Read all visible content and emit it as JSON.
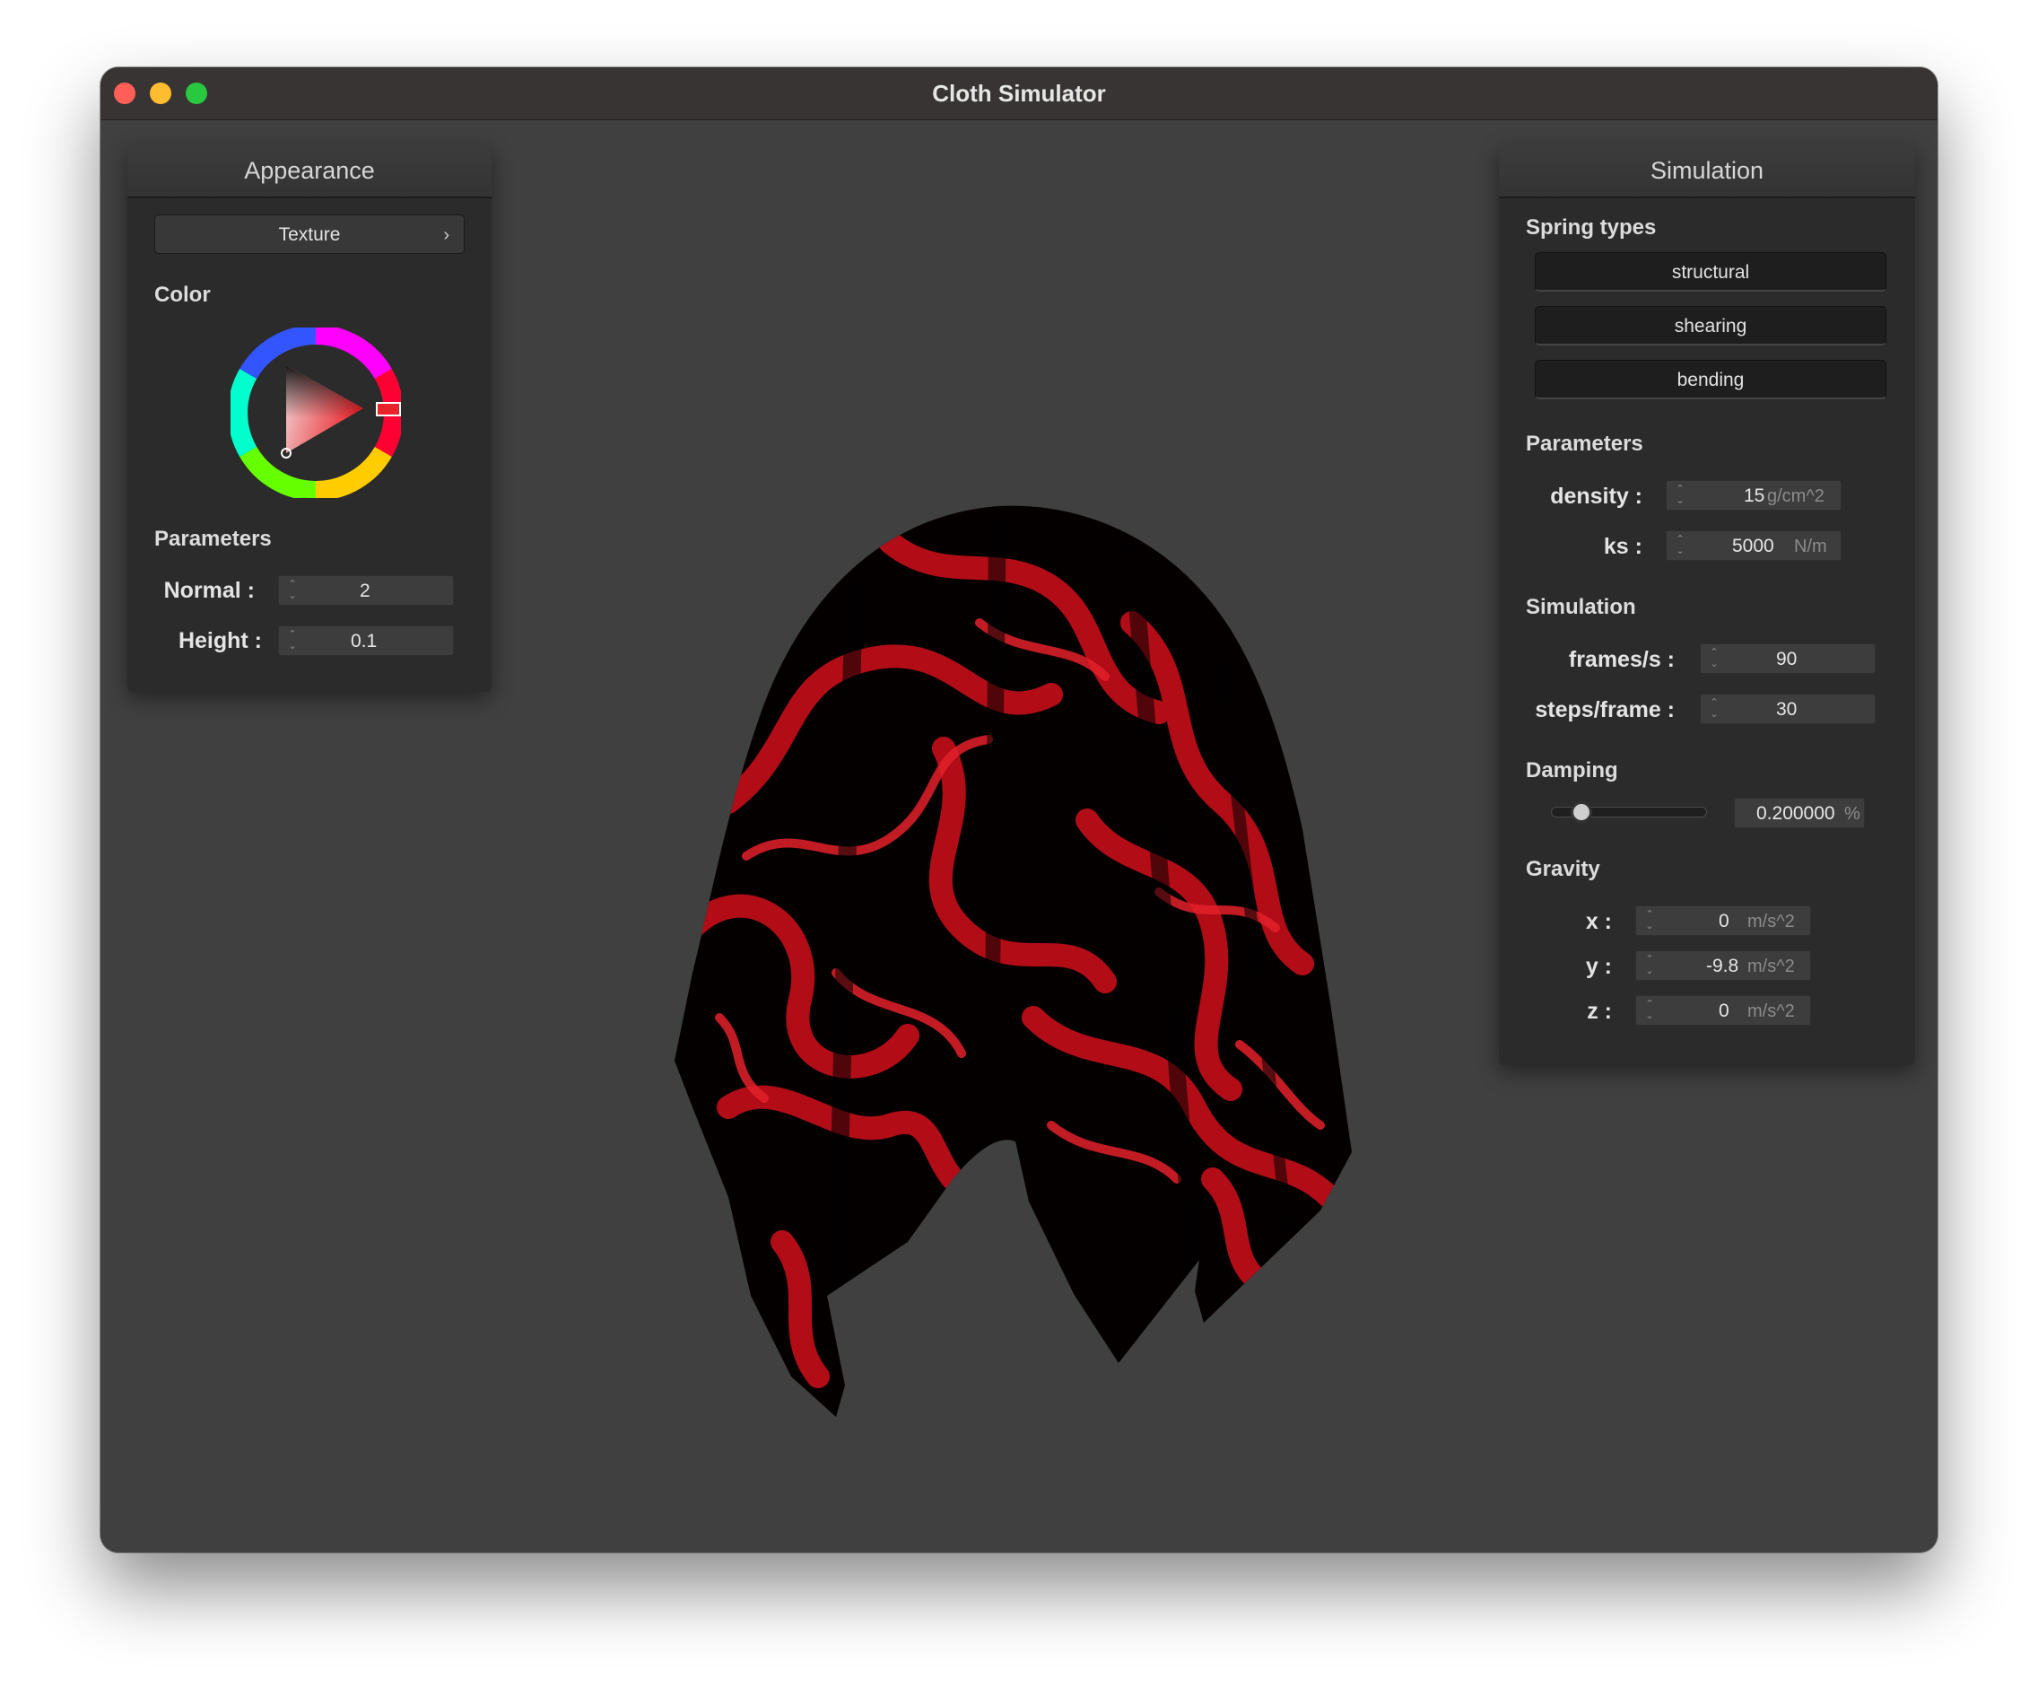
{
  "window": {
    "title": "Cloth Simulator"
  },
  "appearance": {
    "header": "Appearance",
    "texture_button": "Texture",
    "color_label": "Color",
    "params_label": "Parameters",
    "normal": {
      "label": "Normal :",
      "value": "2"
    },
    "height": {
      "label": "Height :",
      "value": "0.1"
    }
  },
  "simulation": {
    "header": "Simulation",
    "spring_types_label": "Spring types",
    "spring_types": [
      "structural",
      "shearing",
      "bending"
    ],
    "params_label": "Parameters",
    "density": {
      "label": "density :",
      "value": "15",
      "unit": "g/cm^2"
    },
    "ks": {
      "label": "ks :",
      "value": "5000",
      "unit": "N/m"
    },
    "simulation_label": "Simulation",
    "frames": {
      "label": "frames/s :",
      "value": "90"
    },
    "steps": {
      "label": "steps/frame :",
      "value": "30"
    },
    "damping_label": "Damping",
    "damping": {
      "value": "0.200000",
      "unit": "%",
      "fraction": 0.2
    },
    "gravity_label": "Gravity",
    "gx": {
      "label": "x :",
      "value": "0",
      "unit": "m/s^2"
    },
    "gy": {
      "label": "y :",
      "value": "-9.8",
      "unit": "m/s^2"
    },
    "gz": {
      "label": "z :",
      "value": "0",
      "unit": "m/s^2"
    }
  },
  "colors": {
    "cloth_base": "#050000",
    "cloth_accent": "#c8101a",
    "selected_color": "#e8232a"
  }
}
